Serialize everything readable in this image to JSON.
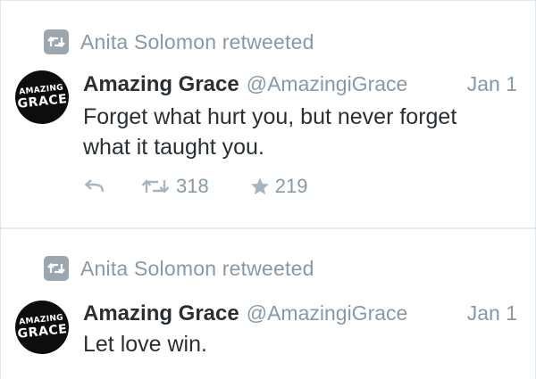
{
  "tweets": [
    {
      "retweet_label": "Anita Solomon retweeted",
      "avatar": {
        "line1": "AMAZING",
        "line2": "GRACE"
      },
      "name": "Amazing Grace",
      "handle": "@AmazingiGrace",
      "date": "Jan 1",
      "text": "Forget what hurt you, but never forget what it taught you.",
      "retweets": "318",
      "likes": "219"
    },
    {
      "retweet_label": "Anita Solomon retweeted",
      "avatar": {
        "line1": "AMAZING",
        "line2": "GRACE"
      },
      "name": "Amazing Grace",
      "handle": "@AmazingiGrace",
      "date": "Jan 1",
      "text": "Let love win."
    }
  ],
  "icons": {
    "retweet_badge": "retweet-icon",
    "reply": "reply-icon",
    "retweet": "retweet-icon",
    "like": "star-icon"
  },
  "colors": {
    "secondary_text": "#8899a6",
    "primary_text": "#292f33",
    "action_icon": "#a8b5bf",
    "avatar_bg": "#0d0d0d"
  }
}
